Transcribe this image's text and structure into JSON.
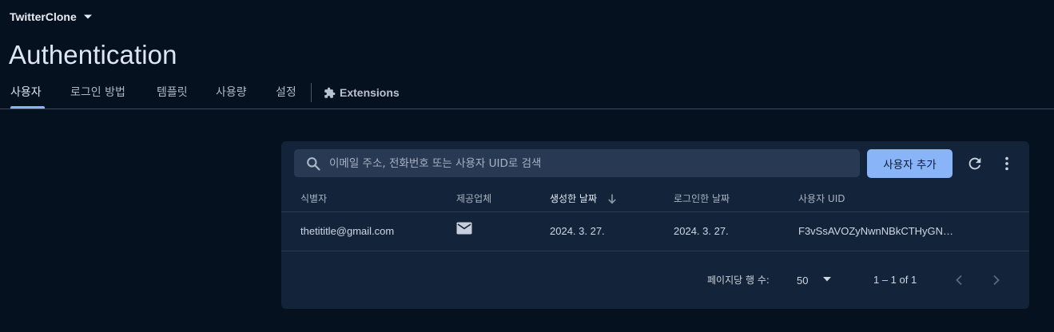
{
  "header": {
    "project_name": "TwitterClone",
    "title": "Authentication"
  },
  "tabs": [
    {
      "label": "사용자",
      "active": true
    },
    {
      "label": "로그인 방법"
    },
    {
      "label": "템플릿"
    },
    {
      "label": "사용량"
    },
    {
      "label": "설정"
    }
  ],
  "extensions_tab": {
    "label": "Extensions",
    "icon": "puzzle-piece-icon"
  },
  "toolbar": {
    "search_placeholder": "이메일 주소, 전화번호 또는 사용자 UID로 검색",
    "search_value": "",
    "add_user_label": "사용자 추가",
    "refresh_icon": "refresh-icon",
    "more_icon": "more-vert-icon"
  },
  "table": {
    "columns": [
      "식별자",
      "제공업체",
      "생성한 날짜",
      "로그인한 날짜",
      "사용자 UID"
    ],
    "sorted_column": "생성한 날짜",
    "sort_direction": "descending",
    "rows": [
      {
        "identifier": "thetititle@gmail.com",
        "provider_icon": "email-icon",
        "created": "2024. 3. 27.",
        "signed_in": "2024. 3. 27.",
        "uid": "F3vSsAVOZyNwnNBkCTHyGN…"
      }
    ]
  },
  "pagination": {
    "rows_per_page_label": "페이지당 행 수:",
    "rows_per_page": "50",
    "range": "1 – 1 of 1"
  },
  "colors": {
    "background": "#06111f",
    "card": "#13233a",
    "accent": "#8ab4f8"
  }
}
